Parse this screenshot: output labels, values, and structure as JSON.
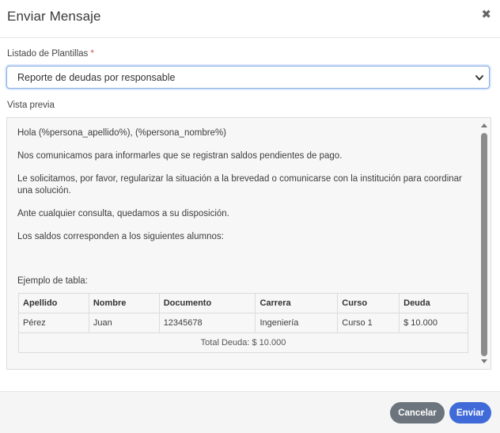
{
  "modal": {
    "title": "Enviar Mensaje",
    "close_glyph": "✖"
  },
  "templates": {
    "label": "Listado de Plantillas",
    "required_mark": "*",
    "selected": "Reporte de deudas por responsable"
  },
  "preview": {
    "label": "Vista previa",
    "paragraphs": [
      "Hola (%persona_apellido%), (%persona_nombre%)",
      "Nos comunicamos para informarles que se registran saldos pendientes de pago.",
      "Le solicitamos, por favor, regularizar la situación a la brevedad o comunicarse con la institución para coordinar una solución.",
      "Ante cualquier consulta, quedamos a su disposición.",
      "Los saldos corresponden a los siguientes alumnos:"
    ],
    "example_label": "Ejemplo de tabla:",
    "table": {
      "headers": [
        "Apellido",
        "Nombre",
        "Documento",
        "Carrera",
        "Curso",
        "Deuda"
      ],
      "rows": [
        [
          "Pérez",
          "Juan",
          "12345678",
          "Ingeniería",
          "Curso 1",
          "$ 10.000"
        ]
      ],
      "total": "Total Deuda: $ 10.000"
    }
  },
  "footer": {
    "cancel_label": "Cancelar",
    "send_label": "Enviar"
  },
  "colors": {
    "send_button": "#3f6ad8",
    "cancel_button": "#6c757d",
    "required": "#d9534f"
  }
}
